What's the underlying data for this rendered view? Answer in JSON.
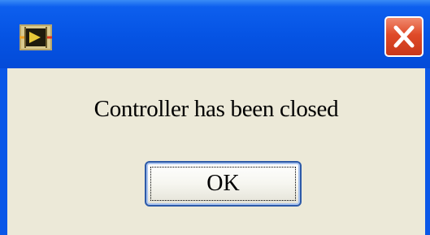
{
  "window": {
    "app_icon": "labview-vi-icon",
    "close_icon": "close-icon"
  },
  "dialog": {
    "message": "Controller has been closed",
    "ok_label": "OK"
  },
  "colors": {
    "title_bar": "#0553e3",
    "close_button": "#df4a28",
    "dialog_background": "#ece9d8"
  }
}
